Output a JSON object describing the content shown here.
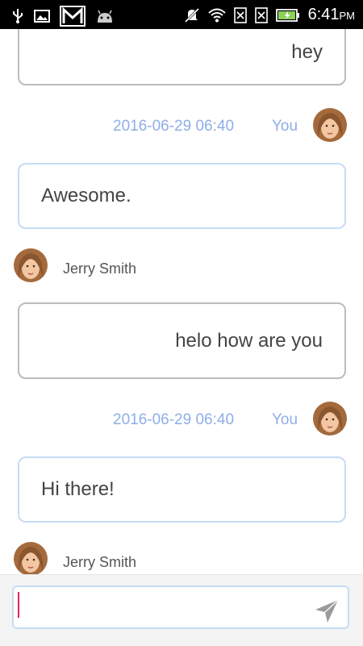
{
  "status_bar": {
    "time": "6:41",
    "ampm": "PM",
    "icons": [
      "usb-icon",
      "image-icon",
      "gmail-icon",
      "android-icon",
      "mute-icon",
      "wifi-icon",
      "no-sim-icon",
      "no-sim-icon",
      "battery-charging-icon"
    ]
  },
  "messages": [
    {
      "text": "hey",
      "direction": "outgoing",
      "timestamp": "2016-06-29 06:40",
      "sender": "You"
    },
    {
      "text": "Awesome.",
      "direction": "incoming",
      "sender": "Jerry Smith"
    },
    {
      "text": "helo how are you",
      "direction": "outgoing",
      "timestamp": "2016-06-29 06:40",
      "sender": "You"
    },
    {
      "text": "Hi there!",
      "direction": "incoming",
      "sender": "Jerry Smith"
    }
  ],
  "composer": {
    "value": "",
    "placeholder": ""
  },
  "colors": {
    "accent": "#8eaee8",
    "incoming_border": "#c6dcf5",
    "outgoing_border": "#bcbcbc",
    "caret": "#e0245e"
  }
}
